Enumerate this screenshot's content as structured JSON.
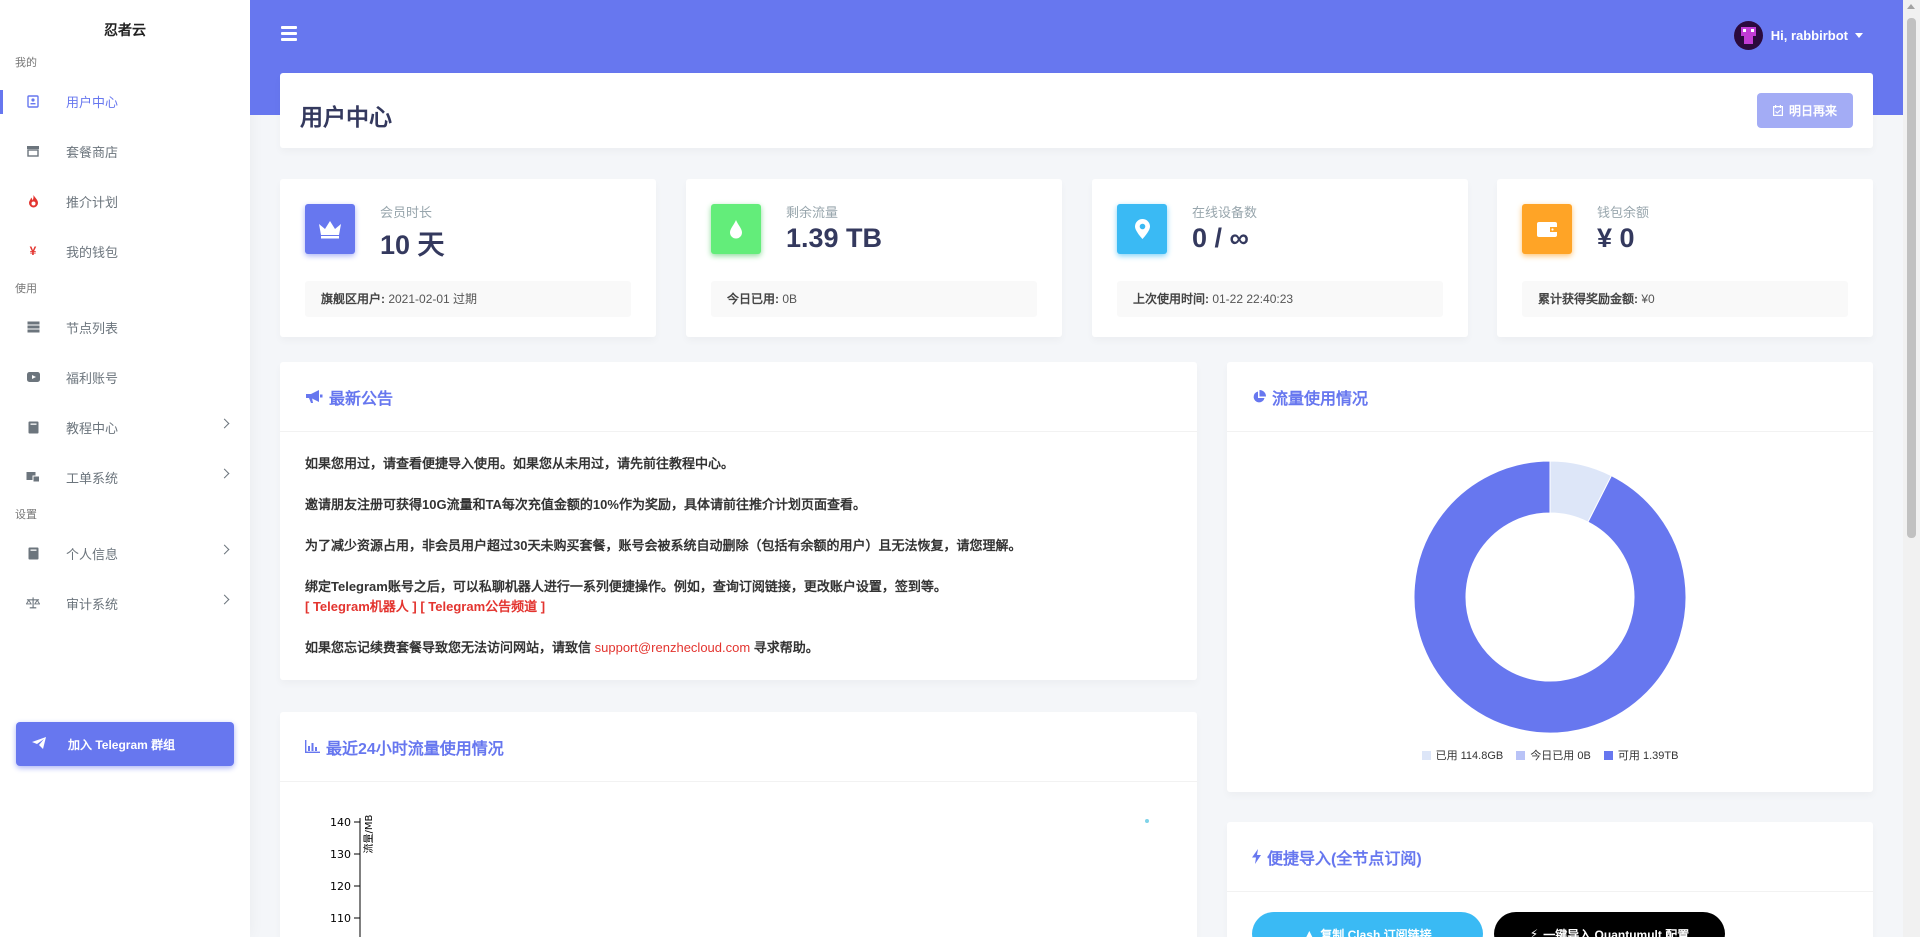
{
  "sidebar": {
    "brand": "忍者云",
    "sections": {
      "mine": "我的",
      "use": "使用",
      "settings": "设置"
    },
    "items": {
      "user_center": "用户中心",
      "shop": "套餐商店",
      "referral": "推介计划",
      "wallet": "我的钱包",
      "nodes": "节点列表",
      "welfare": "福利账号",
      "tutorial": "教程中心",
      "ticket": "工单系统",
      "profile": "个人信息",
      "audit": "审计系统"
    },
    "telegram_button": "加入 Telegram 群组"
  },
  "header": {
    "user_greeting": "Hi, rabbirbot"
  },
  "section": {
    "title": "用户中心",
    "checkin_button": "明日再来"
  },
  "stats": {
    "membership": {
      "label": "会员时长",
      "value": "10 天",
      "foot_label": "旗舰区用户:",
      "foot_value": " 2021-02-01 过期"
    },
    "traffic": {
      "label": "剩余流量",
      "value": "1.39 TB",
      "foot_label": "今日已用:",
      "foot_value": " 0B"
    },
    "devices": {
      "label": "在线设备数",
      "value": "0 / ∞",
      "foot_label": "上次使用时间:",
      "foot_value": " 01-22 22:40:23"
    },
    "balance": {
      "label": "钱包余额",
      "value": "¥ 0",
      "foot_label": "累计获得奖励金额:",
      "foot_value": " ¥0"
    }
  },
  "announcement": {
    "title": "最新公告",
    "p1": "如果您用过，请查看便捷导入使用。如果您从未用过，请先前往教程中心。",
    "p2": "邀请朋友注册可获得10G流量和TA每次充值金额的10%作为奖励，具体请前往推介计划页面查看。",
    "p3": "为了减少资源占用，非会员用户超过30天未购买套餐，账号会被系统自动删除（包括有余额的用户）且无法恢复，请您理解。",
    "p4": "绑定Telegram账号之后，可以私聊机器人进行一系列便捷操作。例如，查询订阅链接，更改账户设置，签到等。",
    "link_bot": "[ Telegram机器人 ]",
    "link_channel": "[ Telegram公告频道 ]",
    "p5_pre": "如果您忘记续费套餐导致您无法访问网站，请致信 ",
    "p5_email": "support@renzhecloud.com",
    "p5_post": " 寻求帮助。"
  },
  "traffic_usage": {
    "title": "流量使用情况",
    "legend": {
      "used": "已用 114.8GB",
      "today": "今日已用 0B",
      "available": "可用 1.39TB"
    },
    "colors": {
      "used": "#dde6f8",
      "today": "#b9c3f7",
      "available": "#6777ef"
    }
  },
  "traffic_24h": {
    "title": "最近24小时流量使用情况"
  },
  "chart_data": [
    {
      "type": "pie",
      "categories": [
        "已用",
        "今日已用",
        "可用"
      ],
      "values": [
        114.8,
        0,
        1423.4
      ],
      "unit": "GB"
    },
    {
      "type": "scatter",
      "ylabel": "流量/MB",
      "yticks": [
        110,
        120,
        130,
        140
      ],
      "points": [
        {
          "x": 23,
          "y": 140
        }
      ]
    }
  ],
  "quick_import": {
    "title": "便捷导入(全节点订阅)",
    "clash_button": "复制 Clash 订阅链接",
    "quantumult_button": "一键导入 Quantumult 配置"
  }
}
